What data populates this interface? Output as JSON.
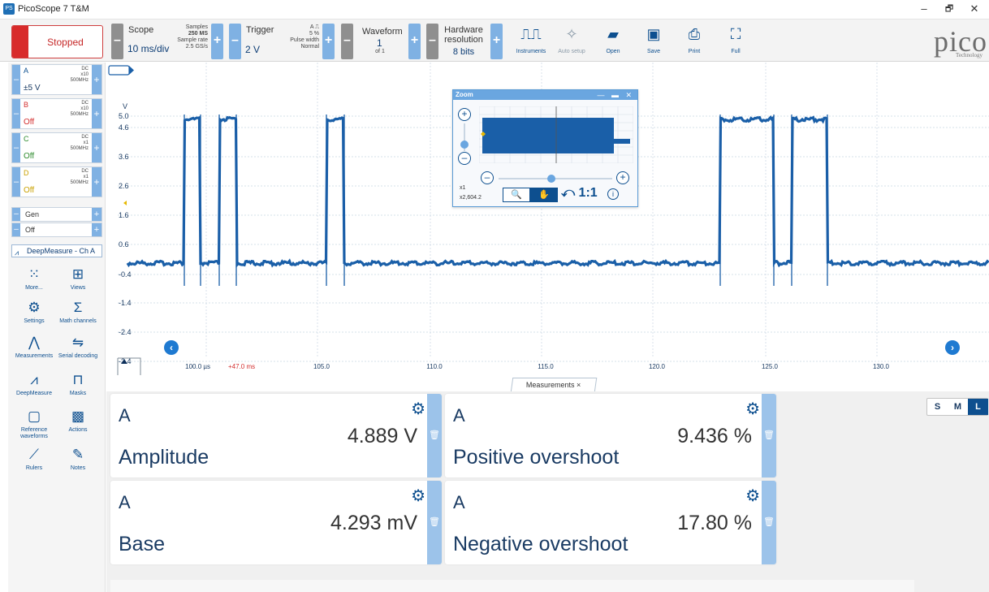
{
  "window": {
    "title": "PicoScope 7 T&M",
    "icon_text": "PS",
    "controls": [
      "–",
      "🗗",
      "✕"
    ]
  },
  "toolbar": {
    "run_state": "Stopped",
    "scope": {
      "label": "Scope",
      "value": "10 ms/div",
      "samples_label": "Samples",
      "samples_value": "250 MS",
      "rate_label": "Sample rate",
      "rate_value": "2.5 GS/s"
    },
    "trigger": {
      "label": "Trigger",
      "value": "2 V",
      "channel": "A",
      "pct": "5 %",
      "type": "Pulse width",
      "mode": "Normal"
    },
    "waveform": {
      "label": "Waveform",
      "value": "1",
      "of": "of 1"
    },
    "resolution": {
      "label_line1": "Hardware",
      "label_line2": "resolution",
      "value": "8 bits"
    },
    "buttons": [
      {
        "label": "Instruments",
        "icon": "instruments-icon",
        "glyph": "⎍⎍"
      },
      {
        "label": "Auto setup",
        "icon": "wand-icon",
        "glyph": "✧"
      },
      {
        "label": "Open",
        "icon": "folder-icon",
        "glyph": "▰"
      },
      {
        "label": "Save",
        "icon": "save-icon",
        "glyph": "▣"
      },
      {
        "label": "Print",
        "icon": "print-icon",
        "glyph": "⎙"
      },
      {
        "label": "Full",
        "icon": "fullscreen-icon",
        "glyph": "⛶"
      }
    ],
    "logo_word": "pico",
    "logo_sub": "Technology"
  },
  "channels": [
    {
      "name": "A",
      "coupling": "DC",
      "probe": "x10",
      "bw": "500MHz",
      "state": "±5 V",
      "color": "#0d4f8f"
    },
    {
      "name": "B",
      "coupling": "DC",
      "probe": "x10",
      "bw": "500MHz",
      "state": "Off",
      "color": "#d32f2f"
    },
    {
      "name": "C",
      "coupling": "DC",
      "probe": "x1",
      "bw": "500MHz",
      "state": "Off",
      "color": "#2e8b2e"
    },
    {
      "name": "D",
      "coupling": "DC",
      "probe": "x1",
      "bw": "500MHz",
      "state": "Off",
      "color": "#c9a100"
    }
  ],
  "generator": {
    "label": "Gen",
    "state": "Off"
  },
  "deepmeasure_button": "DeepMeasure - Ch A",
  "side_tools": [
    {
      "label": "More...",
      "icon": "more-icon",
      "glyph": "⁙"
    },
    {
      "label": "Views",
      "icon": "views-icon",
      "glyph": "⊞"
    },
    {
      "label": "Settings",
      "icon": "gear-icon",
      "glyph": "⚙"
    },
    {
      "label": "Math channels",
      "icon": "sigma-icon",
      "glyph": "Σ"
    },
    {
      "label": "Measurements",
      "icon": "measure-icon",
      "glyph": "⋀"
    },
    {
      "label": "Serial decoding",
      "icon": "serial-icon",
      "glyph": "⇋"
    },
    {
      "label": "DeepMeasure",
      "icon": "deepmeasure-icon",
      "glyph": "⩘"
    },
    {
      "label": "Masks",
      "icon": "masks-icon",
      "glyph": "⊓"
    },
    {
      "label": "Reference waveforms",
      "icon": "reference-icon",
      "glyph": "▢"
    },
    {
      "label": "Actions",
      "icon": "actions-icon",
      "glyph": "▩"
    },
    {
      "label": "Rulers",
      "icon": "ruler-icon",
      "glyph": "⟋"
    },
    {
      "label": "Notes",
      "icon": "notes-icon",
      "glyph": "✎"
    }
  ],
  "scope_view": {
    "y_unit": "V",
    "y_ticks": [
      "5.0",
      "4.6",
      "3.6",
      "2.6",
      "1.6",
      "0.6",
      "-0.4",
      "-1.4",
      "-2.4",
      "-3.4"
    ],
    "x_ticks": [
      "100.0 µs",
      "105.0",
      "110.0",
      "115.0",
      "120.0",
      "125.0",
      "130.0"
    ],
    "trigger_offset": "+47.0 ms",
    "colors": {
      "trace": "#1a5fa8",
      "grid": "#c9d6e3",
      "trigger_offset": "#d32f2f",
      "marker": "#e6b800"
    }
  },
  "zoom_overview": {
    "title": "Zoom",
    "controls": "— ▬ ✕",
    "x_zoom": "x1",
    "y_zoom": "x2,604.2",
    "reset": "⤺ 1:1",
    "tool_zoom": "🔍",
    "tool_pan": "✋",
    "info": "i"
  },
  "measurements": {
    "tab_label": "Measurements ×",
    "cards": [
      {
        "channel": "A",
        "name": "Amplitude",
        "value": "4.889 V"
      },
      {
        "channel": "A",
        "name": "Positive overshoot",
        "value": "9.436 %"
      },
      {
        "channel": "A",
        "name": "Base",
        "value": "4.293 mV"
      },
      {
        "channel": "A",
        "name": "Negative overshoot",
        "value": "17.80 %"
      }
    ],
    "size_options": [
      "S",
      "M",
      "L"
    ],
    "size_selected": "L"
  }
}
